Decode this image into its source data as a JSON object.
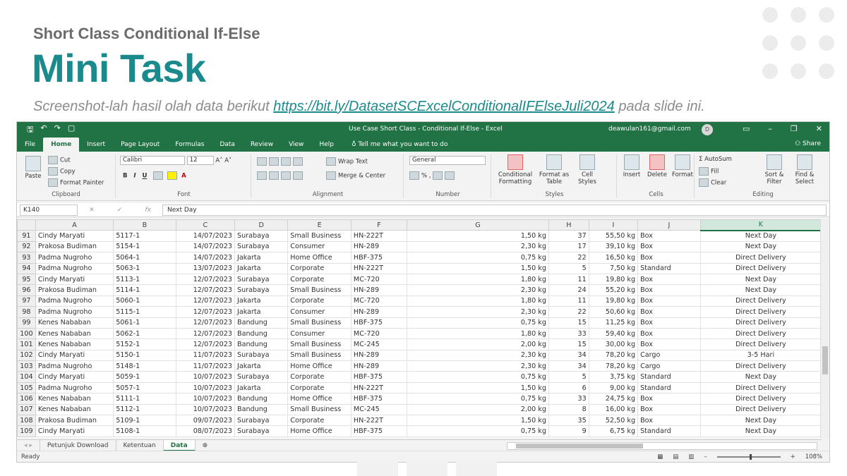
{
  "slide": {
    "subtitle": "Short Class Conditional If-Else",
    "title": "Mini Task",
    "desc_before": "Screenshot-lah hasil olah data berikut ",
    "desc_link": "https://bit.ly/DatasetSCExcelConditionalIFElseJuli2024",
    "desc_after": " pada slide ini."
  },
  "excel": {
    "window_title": "Use Case Short Class - Conditional If-Else  -  Excel",
    "account": "deawulan161@gmail.com",
    "avatar_initial": "D",
    "ribbon_tabs": [
      "File",
      "Home",
      "Insert",
      "Page Layout",
      "Formulas",
      "Data",
      "Review",
      "View",
      "Help"
    ],
    "tell_me": "Tell me what you want to do",
    "share": "Share",
    "clipboard": {
      "paste": "Paste",
      "cut": "Cut",
      "copy": "Copy",
      "format_painter": "Format Painter",
      "label": "Clipboard"
    },
    "font": {
      "name": "Calibri",
      "size": "12",
      "label": "Font"
    },
    "alignment": {
      "wrap": "Wrap Text",
      "merge": "Merge & Center",
      "label": "Alignment"
    },
    "number": {
      "format": "General",
      "label": "Number"
    },
    "styles": {
      "cond": "Conditional Formatting",
      "table": "Format as Table",
      "cell": "Cell Styles",
      "label": "Styles"
    },
    "cells": {
      "insert": "Insert",
      "delete": "Delete",
      "format": "Format",
      "label": "Cells"
    },
    "editing": {
      "autosum": "AutoSum",
      "fill": "Fill",
      "clear": "Clear",
      "sort": "Sort & Filter",
      "find": "Find & Select",
      "label": "Editing"
    },
    "name_box": "K140",
    "formula": "Next Day",
    "columns": [
      "A",
      "B",
      "C",
      "D",
      "E",
      "F",
      "G",
      "H",
      "I",
      "J",
      "K"
    ],
    "rows": [
      {
        "n": "91",
        "a": "Cindy Maryati",
        "b": "5117-1",
        "c": "14/07/2023",
        "d": "Surabaya",
        "e": "Small Business",
        "f": "HN-222T",
        "g": "1,50 kg",
        "h": "37",
        "i": "55,50 kg",
        "j": "Box",
        "k": "Next Day"
      },
      {
        "n": "92",
        "a": "Prakosa Budiman",
        "b": "5154-1",
        "c": "14/07/2023",
        "d": "Surabaya",
        "e": "Consumer",
        "f": "HN-289",
        "g": "2,30 kg",
        "h": "17",
        "i": "39,10 kg",
        "j": "Box",
        "k": "Next Day"
      },
      {
        "n": "93",
        "a": "Padma Nugroho",
        "b": "5064-1",
        "c": "14/07/2023",
        "d": "Jakarta",
        "e": "Home Office",
        "f": "HBF-375",
        "g": "0,75 kg",
        "h": "22",
        "i": "16,50 kg",
        "j": "Box",
        "k": "Direct Delivery"
      },
      {
        "n": "94",
        "a": "Padma Nugroho",
        "b": "5063-1",
        "c": "13/07/2023",
        "d": "Jakarta",
        "e": "Corporate",
        "f": "HN-222T",
        "g": "1,50 kg",
        "h": "5",
        "i": "7,50 kg",
        "j": "Standard",
        "k": "Direct Delivery"
      },
      {
        "n": "95",
        "a": "Cindy Maryati",
        "b": "5113-1",
        "c": "12/07/2023",
        "d": "Surabaya",
        "e": "Corporate",
        "f": "MC-720",
        "g": "1,80 kg",
        "h": "11",
        "i": "19,80 kg",
        "j": "Box",
        "k": "Next Day"
      },
      {
        "n": "96",
        "a": "Prakosa Budiman",
        "b": "5114-1",
        "c": "12/07/2023",
        "d": "Surabaya",
        "e": "Small Business",
        "f": "HN-289",
        "g": "2,30 kg",
        "h": "24",
        "i": "55,20 kg",
        "j": "Box",
        "k": "Next Day"
      },
      {
        "n": "97",
        "a": "Padma Nugroho",
        "b": "5060-1",
        "c": "12/07/2023",
        "d": "Jakarta",
        "e": "Corporate",
        "f": "MC-720",
        "g": "1,80 kg",
        "h": "11",
        "i": "19,80 kg",
        "j": "Box",
        "k": "Direct Delivery"
      },
      {
        "n": "98",
        "a": "Padma Nugroho",
        "b": "5115-1",
        "c": "12/07/2023",
        "d": "Jakarta",
        "e": "Consumer",
        "f": "HN-289",
        "g": "2,30 kg",
        "h": "22",
        "i": "50,60 kg",
        "j": "Box",
        "k": "Direct Delivery"
      },
      {
        "n": "99",
        "a": "Kenes Nababan",
        "b": "5061-1",
        "c": "12/07/2023",
        "d": "Bandung",
        "e": "Small Business",
        "f": "HBF-375",
        "g": "0,75 kg",
        "h": "15",
        "i": "11,25 kg",
        "j": "Box",
        "k": "Direct Delivery"
      },
      {
        "n": "100",
        "a": "Kenes Nababan",
        "b": "5062-1",
        "c": "12/07/2023",
        "d": "Bandung",
        "e": "Consumer",
        "f": "MC-720",
        "g": "1,80 kg",
        "h": "33",
        "i": "59,40 kg",
        "j": "Box",
        "k": "Direct Delivery"
      },
      {
        "n": "101",
        "a": "Kenes Nababan",
        "b": "5152-1",
        "c": "12/07/2023",
        "d": "Bandung",
        "e": "Small Business",
        "f": "MC-245",
        "g": "2,00 kg",
        "h": "15",
        "i": "30,00 kg",
        "j": "Box",
        "k": "Direct Delivery"
      },
      {
        "n": "102",
        "a": "Cindy Maryati",
        "b": "5150-1",
        "c": "11/07/2023",
        "d": "Surabaya",
        "e": "Small Business",
        "f": "HN-289",
        "g": "2,30 kg",
        "h": "34",
        "i": "78,20 kg",
        "j": "Cargo",
        "k": "3-5 Hari"
      },
      {
        "n": "103",
        "a": "Padma Nugroho",
        "b": "5148-1",
        "c": "11/07/2023",
        "d": "Jakarta",
        "e": "Home Office",
        "f": "HN-289",
        "g": "2,30 kg",
        "h": "34",
        "i": "78,20 kg",
        "j": "Cargo",
        "k": "Direct Delivery"
      },
      {
        "n": "104",
        "a": "Cindy Maryati",
        "b": "5059-1",
        "c": "10/07/2023",
        "d": "Surabaya",
        "e": "Corporate",
        "f": "HBF-375",
        "g": "0,75 kg",
        "h": "5",
        "i": "3,75 kg",
        "j": "Standard",
        "k": "Next Day"
      },
      {
        "n": "105",
        "a": "Padma Nugroho",
        "b": "5057-1",
        "c": "10/07/2023",
        "d": "Jakarta",
        "e": "Corporate",
        "f": "HN-222T",
        "g": "1,50 kg",
        "h": "6",
        "i": "9,00 kg",
        "j": "Standard",
        "k": "Direct Delivery"
      },
      {
        "n": "106",
        "a": "Kenes Nababan",
        "b": "5111-1",
        "c": "10/07/2023",
        "d": "Bandung",
        "e": "Home Office",
        "f": "HBF-375",
        "g": "0,75 kg",
        "h": "33",
        "i": "24,75 kg",
        "j": "Box",
        "k": "Direct Delivery"
      },
      {
        "n": "107",
        "a": "Kenes Nababan",
        "b": "5112-1",
        "c": "10/07/2023",
        "d": "Bandung",
        "e": "Small Business",
        "f": "MC-245",
        "g": "2,00 kg",
        "h": "8",
        "i": "16,00 kg",
        "j": "Box",
        "k": "Direct Delivery"
      },
      {
        "n": "108",
        "a": "Prakosa Budiman",
        "b": "5109-1",
        "c": "09/07/2023",
        "d": "Surabaya",
        "e": "Corporate",
        "f": "HN-222T",
        "g": "1,50 kg",
        "h": "35",
        "i": "52,50 kg",
        "j": "Box",
        "k": "Next Day"
      },
      {
        "n": "109",
        "a": "Cindy Maryati",
        "b": "5108-1",
        "c": "08/07/2023",
        "d": "Surabaya",
        "e": "Home Office",
        "f": "HBF-375",
        "g": "0,75 kg",
        "h": "9",
        "i": "6,75 kg",
        "j": "Standard",
        "k": "Next Day"
      }
    ],
    "sheet_tabs": [
      "Petunjuk Download",
      "Ketentuan",
      "Data"
    ],
    "status": "Ready",
    "zoom": "108%"
  }
}
